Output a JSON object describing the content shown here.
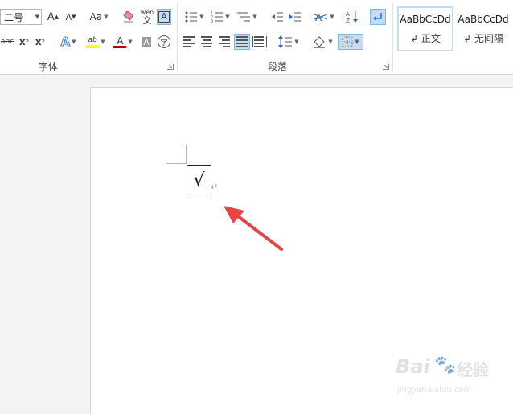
{
  "ribbon": {
    "font_group": {
      "label": "字体",
      "size_value": "二号",
      "grow_label": "A",
      "shrink_label": "A",
      "case_label": "Aa",
      "eraser_icon": "eraser-icon",
      "pinyin_top": "wén",
      "pinyin_bottom": "文",
      "border_char_label": "A",
      "strike_label": "abc",
      "sub_label": "x",
      "sub_mark": "2",
      "sup_label": "x",
      "sup_mark": "2",
      "effects_label": "A",
      "highlight_label": "ab",
      "font_color_label": "A",
      "shade_label": "A",
      "enclose_label": "字"
    },
    "para_group": {
      "label": "段落"
    },
    "styles": [
      {
        "sample": "AaBbCcDd",
        "name": "↲ 正文"
      },
      {
        "sample": "AaBbCcDd",
        "name": "↲ 无间隔"
      }
    ],
    "colors": {
      "highlight": "#ffff00",
      "font_color": "#c00000",
      "active_bg": "#c5dcf2"
    }
  },
  "document": {
    "checkbox_symbol": "√",
    "paragraph_mark": "↵"
  },
  "watermark": {
    "brand": "Bai",
    "paw": "🐾",
    "brand_suffix": "经验",
    "url": "jingyan.baidu.com"
  }
}
